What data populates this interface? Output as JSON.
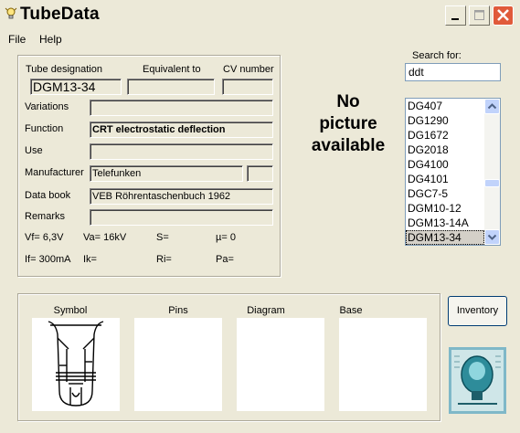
{
  "window": {
    "title": "TubeData"
  },
  "menu": {
    "file": "File",
    "help": "Help"
  },
  "main": {
    "headers": {
      "designation": "Tube designation",
      "equivalent": "Equivalent to",
      "cv": "CV number"
    },
    "designation_value": "DGM13-34",
    "equivalent_value": "",
    "cv_value": "",
    "labels": {
      "variations": "Variations",
      "function": "Function",
      "use": "Use",
      "manufacturer": "Manufacturer",
      "databook": "Data book",
      "remarks": "Remarks"
    },
    "values": {
      "variations": "",
      "function": "CRT electrostatic deflection",
      "use": "",
      "manufacturer": "Telefunken",
      "manufacturer_extra": "",
      "databook": "VEB Röhrentaschenbuch 1962",
      "remarks": ""
    },
    "params": {
      "vf": "Vf= 6,3V",
      "va": "Va= 16kV",
      "s": "S=",
      "mu": "µ=   0",
      "if": "If= 300mA",
      "ik": "Ik=",
      "ri": "Ri=",
      "pa": "Pa="
    }
  },
  "picture": {
    "line1": "No",
    "line2": "picture",
    "line3": "available"
  },
  "search": {
    "label": "Search for:",
    "value": "ddt"
  },
  "list": {
    "items": [
      "DG407",
      "DG1290",
      "DG1672",
      "DG2018",
      "DG4100",
      "DG4101",
      "DGC7-5",
      "DGM10-12",
      "DGM13-14A",
      "DGM13-34"
    ],
    "selected_index": 9
  },
  "images": {
    "symbol": "Symbol",
    "pins": "Pins",
    "diagram": "Diagram",
    "base": "Base"
  },
  "buttons": {
    "inventory": "Inventory"
  },
  "icons": {
    "app": "bulb-icon",
    "minimize": "minimize-icon",
    "maximize": "maximize-icon",
    "close": "close-icon",
    "logo": "tube-logo-icon"
  },
  "colors": {
    "background": "#ece9d8",
    "close": "#e05a3a",
    "scroll": "#c1d3fb"
  }
}
